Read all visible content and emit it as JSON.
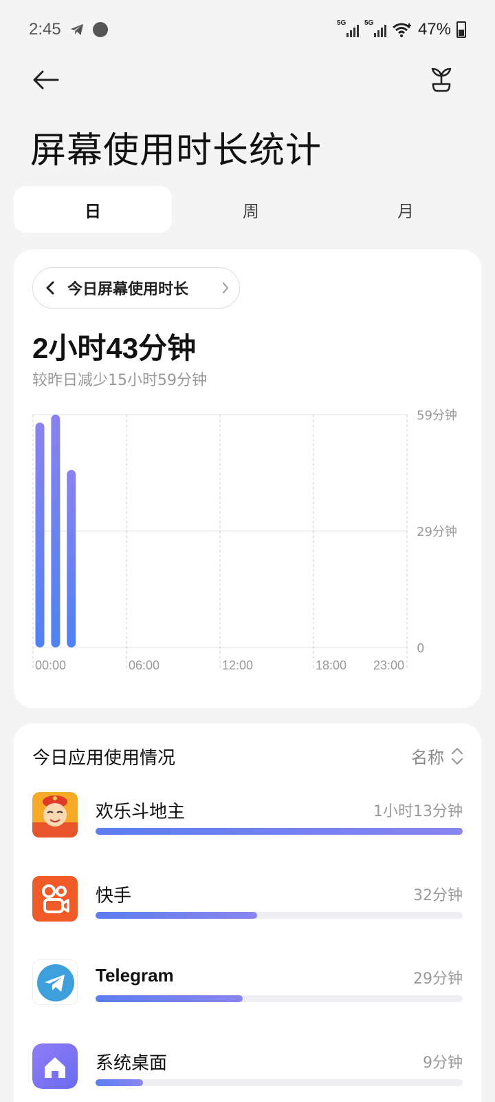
{
  "status_bar": {
    "time": "2:45",
    "network_label": "5G",
    "network_label_2": "5G",
    "battery": "47%"
  },
  "header": {
    "title": "屏幕使用时长统计",
    "back_icon": "arrow-left-icon",
    "action_icon": "sprout-icon"
  },
  "tabs": [
    {
      "label": "日",
      "active": true
    },
    {
      "label": "周",
      "active": false
    },
    {
      "label": "月",
      "active": false
    }
  ],
  "summary": {
    "period_label": "今日屏幕使用时长",
    "total": "2小时43分钟",
    "comparison": "较昨日减少15小时59分钟"
  },
  "chart_data": {
    "type": "bar",
    "x_unit": "hour",
    "x_ticks": [
      "00:00",
      "06:00",
      "12:00",
      "18:00",
      "23:00"
    ],
    "y_ticks": [
      "59分钟",
      "29分钟",
      "0"
    ],
    "ylim": [
      0,
      59
    ],
    "grid": true,
    "bar_color_top": "#8a82ef",
    "bar_color_bottom": "#4f82f3",
    "bars": [
      {
        "hour": 0,
        "value": 57
      },
      {
        "hour": 1,
        "value": 59
      },
      {
        "hour": 2,
        "value": 45
      }
    ]
  },
  "apps_section": {
    "title": "今日应用使用情况",
    "sort_label": "名称",
    "apps": [
      {
        "name": "欢乐斗地主",
        "time": "1小时13分钟",
        "fraction": 1.0,
        "icon": "doudizhu-game-icon"
      },
      {
        "name": "快手",
        "time": "32分钟",
        "fraction": 0.44,
        "icon": "kuaishou-icon"
      },
      {
        "name": "Telegram",
        "time": "29分钟",
        "fraction": 0.4,
        "icon": "telegram-icon"
      },
      {
        "name": "系统桌面",
        "time": "9分钟",
        "fraction": 0.13,
        "icon": "home-launcher-icon"
      }
    ]
  }
}
